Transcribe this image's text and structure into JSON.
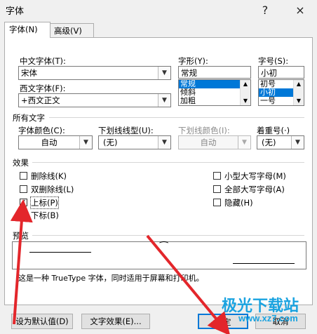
{
  "title": "字体",
  "titlebar": {
    "help": "?",
    "close": "×"
  },
  "tabs": [
    {
      "label": "字体(N)",
      "active": true
    },
    {
      "label": "高级(V)",
      "active": false
    }
  ],
  "fonts": {
    "chinese_label": "中文字体(T):",
    "chinese_value": "宋体",
    "western_label": "西文字体(F):",
    "western_value": "+西文正文",
    "style_label": "字形(Y):",
    "style_value": "常规",
    "style_options": [
      "常规",
      "倾斜",
      "加粗"
    ],
    "style_selected": "常规",
    "size_label": "字号(S):",
    "size_value": "小初",
    "size_options": [
      "初号",
      "小初",
      "一号"
    ],
    "size_selected": "小初"
  },
  "all_text": {
    "heading": "所有文字",
    "color_label": "字体颜色(C):",
    "color_value": "自动",
    "underline_label": "下划线线型(U):",
    "underline_value": "(无)",
    "underline_color_label": "下划线颜色(I):",
    "underline_color_value": "自动",
    "emphasis_label": "着重号(·)",
    "emphasis_value": "(无)"
  },
  "effects": {
    "heading": "效果",
    "left": [
      {
        "label": "删除线(K)",
        "checked": false
      },
      {
        "label": "双删除线(L)",
        "checked": false
      },
      {
        "label": "上标(P)",
        "checked": true
      },
      {
        "label": "下标(B)",
        "checked": false
      }
    ],
    "right": [
      {
        "label": "小型大写字母(M)",
        "checked": false
      },
      {
        "label": "全部大写字母(A)",
        "checked": false
      },
      {
        "label": "隐藏(H)",
        "checked": false
      }
    ]
  },
  "preview": {
    "heading": "预览",
    "sample": "⁀",
    "note": "这是一种 TrueType 字体，同时适用于屏幕和打印机。"
  },
  "buttons": {
    "default": "设为默认值(D)",
    "text_effects": "文字效果(E)...",
    "ok": "确定",
    "cancel": "取消"
  },
  "watermark": {
    "text": "极光下载站",
    "url": "www.xz7.com"
  },
  "colors": {
    "accent": "#0078d7",
    "arrow": "#e3262b",
    "watermark": "#1aa3e0"
  }
}
